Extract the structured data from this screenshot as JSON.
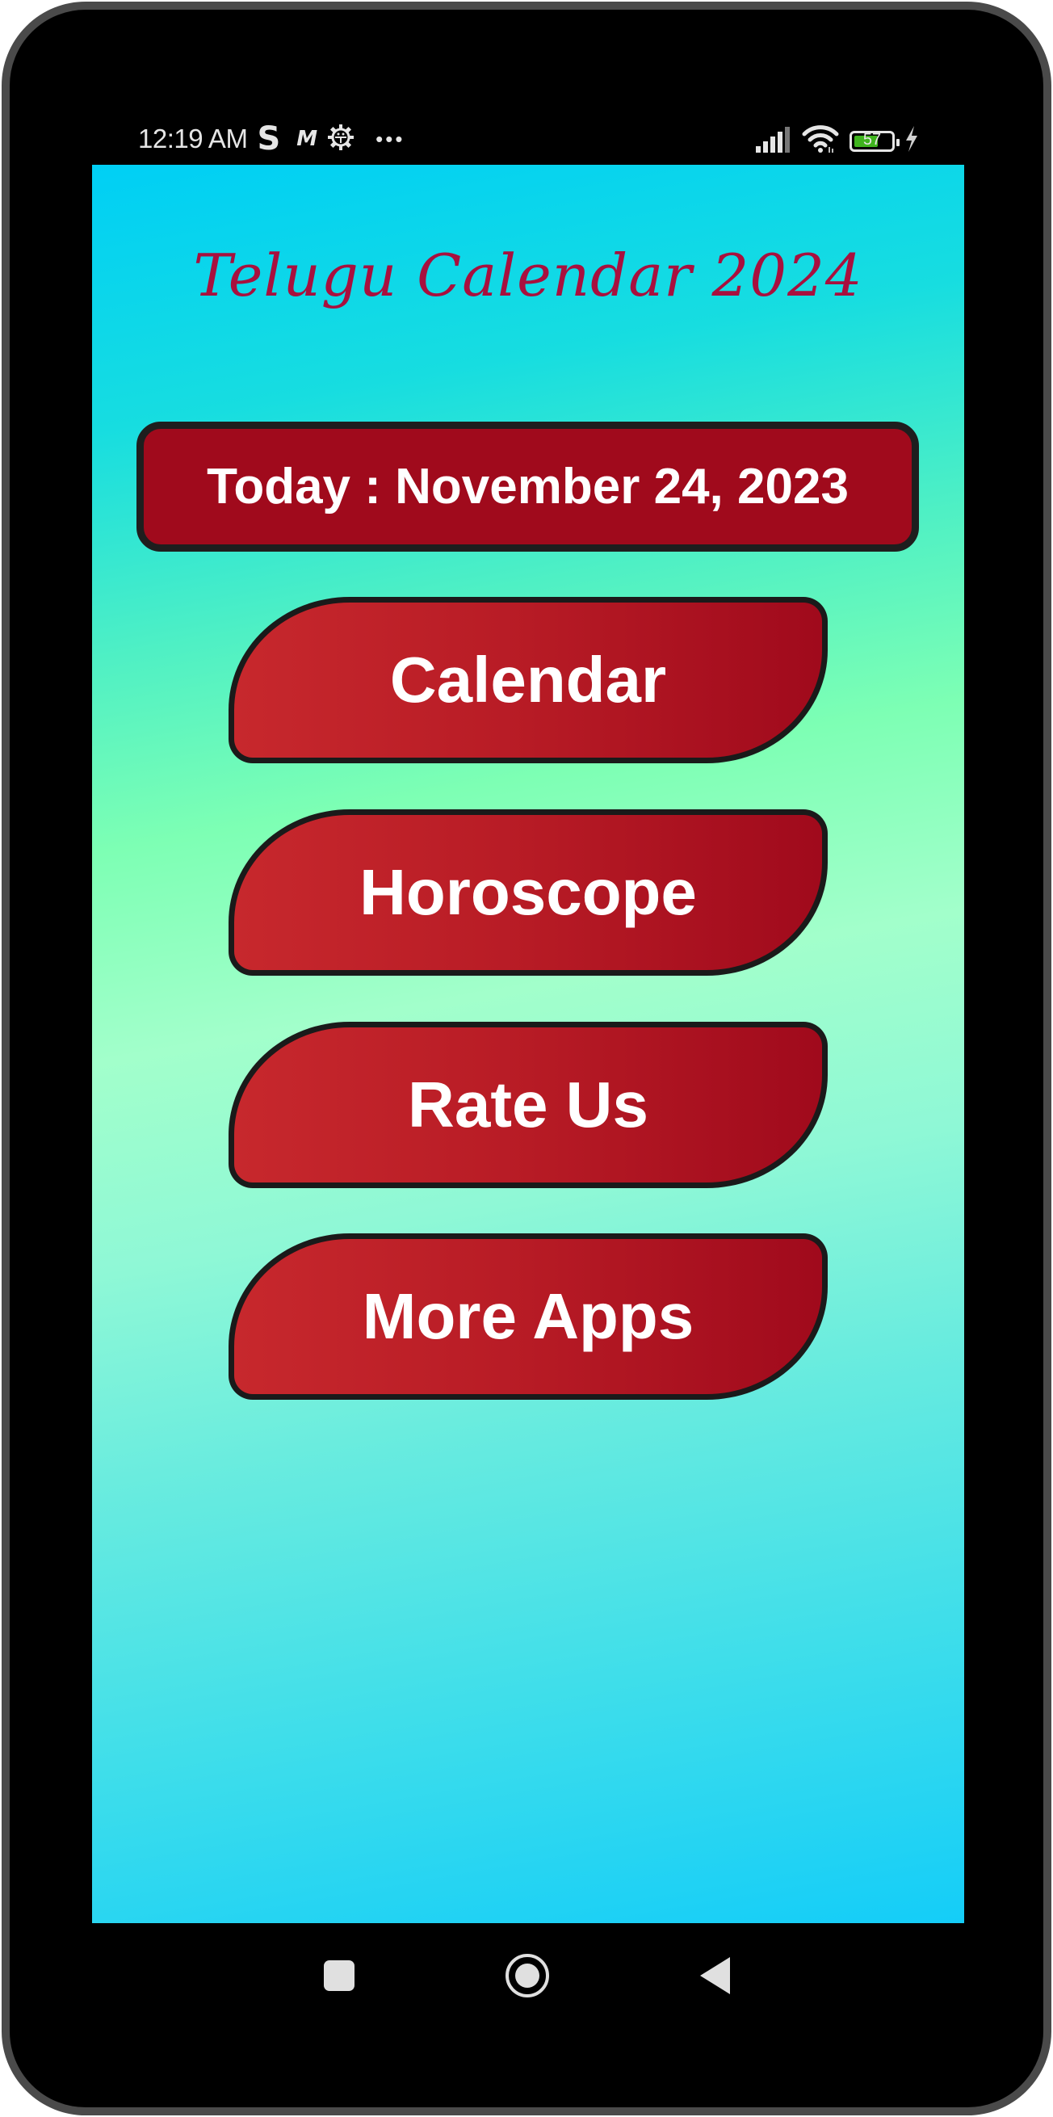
{
  "status_bar": {
    "time": "12:19 AM",
    "notification_icons": [
      "s-app-icon",
      "m-app-icon",
      "android-debug-icon",
      "more-dots-icon"
    ],
    "s_icon_glyph": "S",
    "m_icon_glyph": "M",
    "more_glyph": "•••",
    "battery_percent": 57,
    "battery_label": "57",
    "charging": true,
    "icons_right": [
      "signal-icon",
      "wifi-icon",
      "battery-icon",
      "charging-bolt-icon"
    ]
  },
  "app": {
    "title": "Telugu Calendar 2024",
    "title_color": "#a8103e",
    "today_label": "Today : November 24, 2023",
    "today_box_color": "#a00a1c"
  },
  "menu": {
    "buttons": [
      {
        "label": "Calendar"
      },
      {
        "label": "Horoscope"
      },
      {
        "label": "Rate Us"
      },
      {
        "label": "More Apps"
      }
    ],
    "button_gradient": [
      "#c7282d",
      "#a00a1c"
    ],
    "button_border_color": "#1a1a1a"
  },
  "nav_bar": {
    "buttons": [
      "recents-square-icon",
      "home-circle-icon",
      "back-triangle-icon"
    ]
  }
}
